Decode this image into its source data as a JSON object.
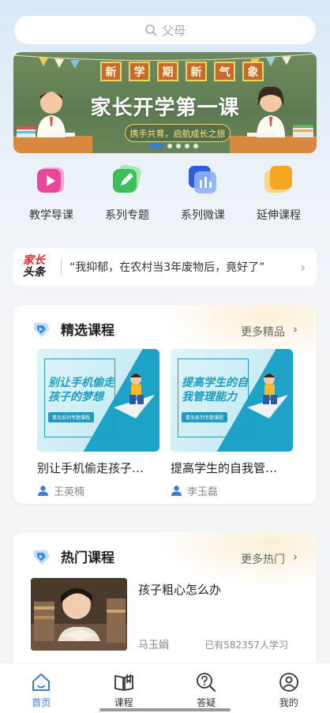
{
  "search": {
    "placeholder": "父母"
  },
  "banner": {
    "top_chars": [
      "新",
      "学",
      "期",
      "新",
      "气",
      "象"
    ],
    "title": "家长开学第一课",
    "pill": "携手共育，启航成长之旅",
    "dots": 5,
    "active_dot": 0
  },
  "categories": [
    {
      "label": "教学导课",
      "icon": "play-icon",
      "color": "#e9489a"
    },
    {
      "label": "系列专题",
      "icon": "edit-icon",
      "color": "#3cbf5a"
    },
    {
      "label": "系列微课",
      "icon": "chart-icon",
      "color": "#3a6fe0"
    },
    {
      "label": "延伸课程",
      "icon": "note-icon",
      "color": "#f5a623"
    }
  ],
  "headline": {
    "logo_top": "家长",
    "logo_bottom": "头条",
    "text": "“我抑郁，在农村当3年废物后，竟好了”"
  },
  "featured": {
    "title": "精选课程",
    "more": "更多精品",
    "courses": [
      {
        "thumb_line1": "别让手机偷走",
        "thumb_line2": "孩子的梦想",
        "tag": "青岛系列专题课程",
        "name": "别让手机偷走孩子…",
        "teacher": "王英楠"
      },
      {
        "thumb_line1": "提高学生的自",
        "thumb_line2": "我管理能力",
        "tag": "青岛系列专题课程",
        "name": "提高学生的自我管…",
        "teacher": "李玉磊"
      }
    ]
  },
  "hot": {
    "title": "热门课程",
    "more": "更多热门",
    "course": {
      "name": "孩子粗心怎么办",
      "teacher": "马玉娟",
      "count": "已有582357人学习"
    }
  },
  "tabs": [
    {
      "label": "首页",
      "icon": "home-icon",
      "active": true
    },
    {
      "label": "课程",
      "icon": "book-icon",
      "active": false
    },
    {
      "label": "答疑",
      "icon": "question-search-icon",
      "active": false
    },
    {
      "label": "我的",
      "icon": "user-icon",
      "active": false
    }
  ],
  "colors": {
    "accent": "#3a7bd5",
    "banner_bg": "#5d7b52"
  }
}
